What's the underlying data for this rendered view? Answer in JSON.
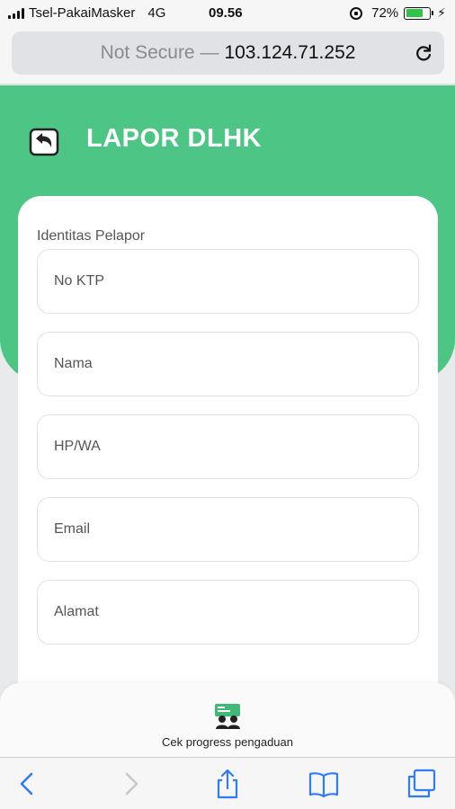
{
  "status_bar": {
    "carrier": "Tsel-PakaiMasker",
    "network": "4G",
    "time": "09.56",
    "battery_percent": "72%",
    "battery_level": 0.72
  },
  "browser": {
    "security_label": "Not Secure —",
    "host": "103.124.71.252"
  },
  "header": {
    "title": "LAPOR DLHK",
    "back_icon": "back-arrow-icon"
  },
  "form": {
    "section_label": "Identitas Pelapor",
    "fields": [
      {
        "placeholder": "No KTP",
        "value": ""
      },
      {
        "placeholder": "Nama",
        "value": ""
      },
      {
        "placeholder": "HP/WA",
        "value": ""
      },
      {
        "placeholder": "Email",
        "value": ""
      },
      {
        "placeholder": "Alamat",
        "value": ""
      }
    ]
  },
  "bottom_nav": {
    "progress_label": "Cek progress pengaduan",
    "progress_icon": "people-board-icon"
  },
  "toolbar": {
    "icons": [
      "back-icon",
      "forward-icon",
      "share-icon",
      "bookmarks-icon",
      "tabs-icon"
    ]
  },
  "colors": {
    "accent": "#4cc585",
    "ios_blue": "#2f7cf6",
    "battery": "#32c24b"
  }
}
